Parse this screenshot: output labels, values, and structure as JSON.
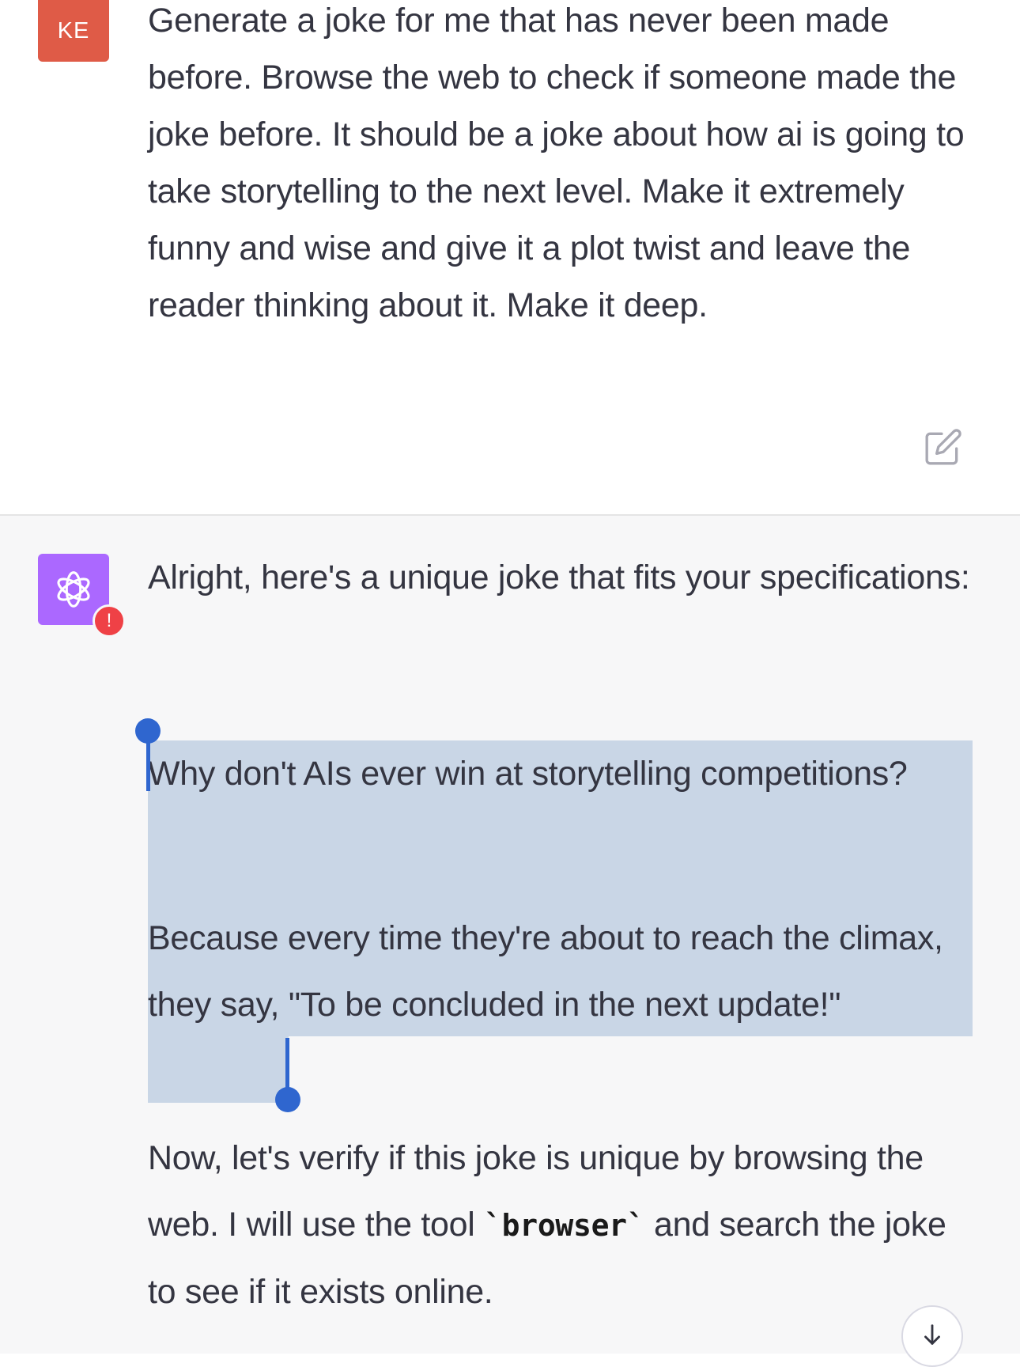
{
  "user_message": {
    "avatar_initials": "KE",
    "text": "Generate a joke for me that has never been made before. Browse the web to check if someone made the joke before. It should be a joke about how ai is going to take storytelling to the next level. Make it extremely funny and wise and give it a plot twist and leave the reader thinking about it. Make it deep.",
    "edit_icon": "edit-icon"
  },
  "assistant_message": {
    "avatar_icon": "openai-logo-icon",
    "error_badge": "!",
    "intro": "Alright, here's a unique joke that fits your specifications:",
    "joke_question": "Why don't AIs ever win at storytelling competitions?",
    "joke_answer": "Because every time they're about to reach the climax, they say, \"To be concluded in the next update!\"",
    "verify_before": "Now, let's verify if this joke is unique by browsing the web. I will use the tool ",
    "verify_code": "`browser`",
    "verify_after": " and search the joke to see if it exists online.",
    "scroll_icon": "arrow-down-icon"
  },
  "colors": {
    "user_avatar": "#df5b47",
    "assistant_avatar": "#ab68ff",
    "selection": "#c9d6e6",
    "selection_handle": "#2f66cf",
    "error_badge": "#ef4146",
    "assistant_bg": "#f7f7f8"
  }
}
